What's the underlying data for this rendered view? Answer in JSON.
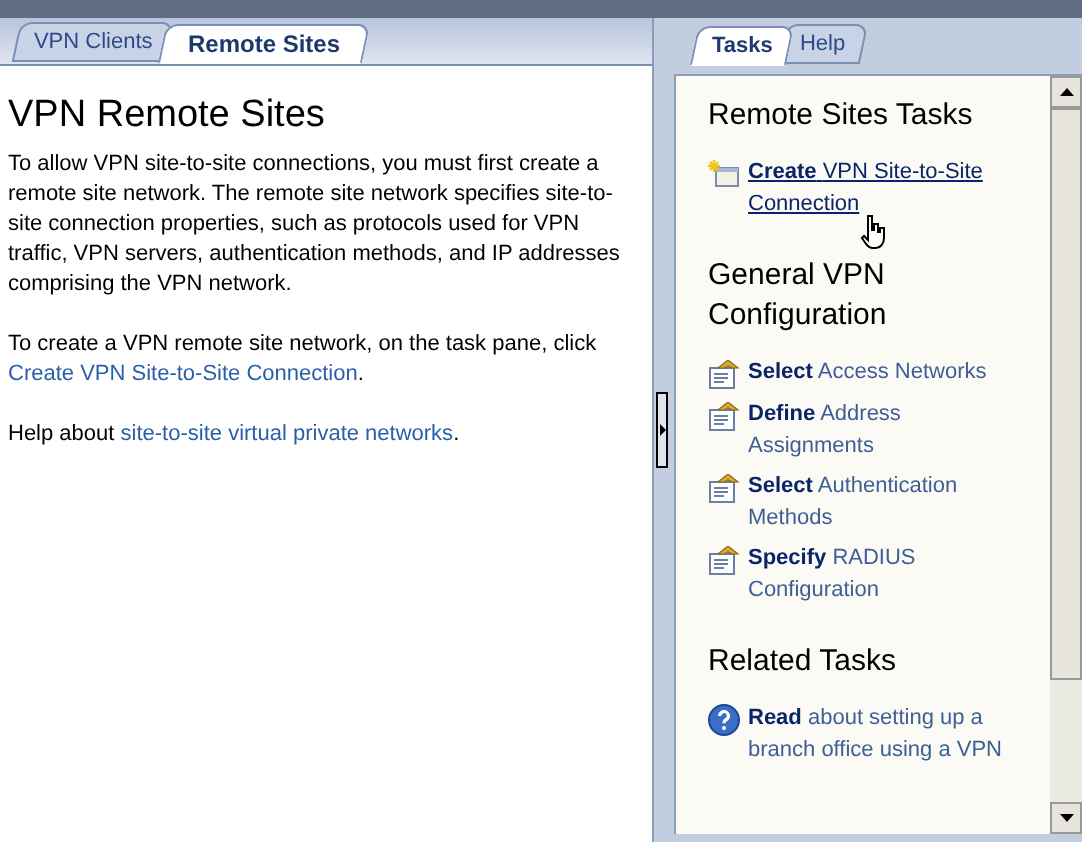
{
  "main_tabs": [
    {
      "label": "VPN Clients",
      "selected": false
    },
    {
      "label": "Remote Sites",
      "selected": true
    }
  ],
  "content": {
    "title": "VPN Remote Sites",
    "paragraphs": [
      {
        "text": "To allow VPN site-to-site connections, you must first create a remote site network. The remote site network specifies site-to-site connection properties, such as protocols used for VPN traffic, VPN servers, authentication methods, and IP addresses comprising the VPN network."
      },
      {
        "text": "To create a VPN remote site network, on the task pane, click",
        "link": "Create VPN Site-to-Site Connection",
        "after": "."
      },
      {
        "text": "Help about",
        "link": "site-to-site virtual private networks",
        "after": "."
      }
    ]
  },
  "pane_tabs": [
    {
      "label": "Tasks",
      "selected": true
    },
    {
      "label": "Help",
      "selected": false
    }
  ],
  "task_sections": [
    {
      "title": "Remote Sites Tasks",
      "items": [
        {
          "kind": "new",
          "verb": "Create",
          "rest": "VPN Site-to-Site Connection",
          "hovered": true
        }
      ]
    },
    {
      "title": "General VPN Configuration",
      "items": [
        {
          "kind": "config",
          "verb": "Select",
          "rest": "Access Networks",
          "hovered": false
        },
        {
          "kind": "config",
          "verb": "Define",
          "rest": "Address Assignments",
          "hovered": false
        },
        {
          "kind": "config",
          "verb": "Select",
          "rest": "Authentication Methods",
          "hovered": false
        },
        {
          "kind": "config",
          "verb": "Specify",
          "rest": "RADIUS Configuration",
          "hovered": false
        }
      ]
    },
    {
      "title": "Related Tasks",
      "items": [
        {
          "kind": "help",
          "verb": "Read",
          "rest": "about setting up a branch office using a VPN",
          "hovered": false
        }
      ]
    }
  ]
}
